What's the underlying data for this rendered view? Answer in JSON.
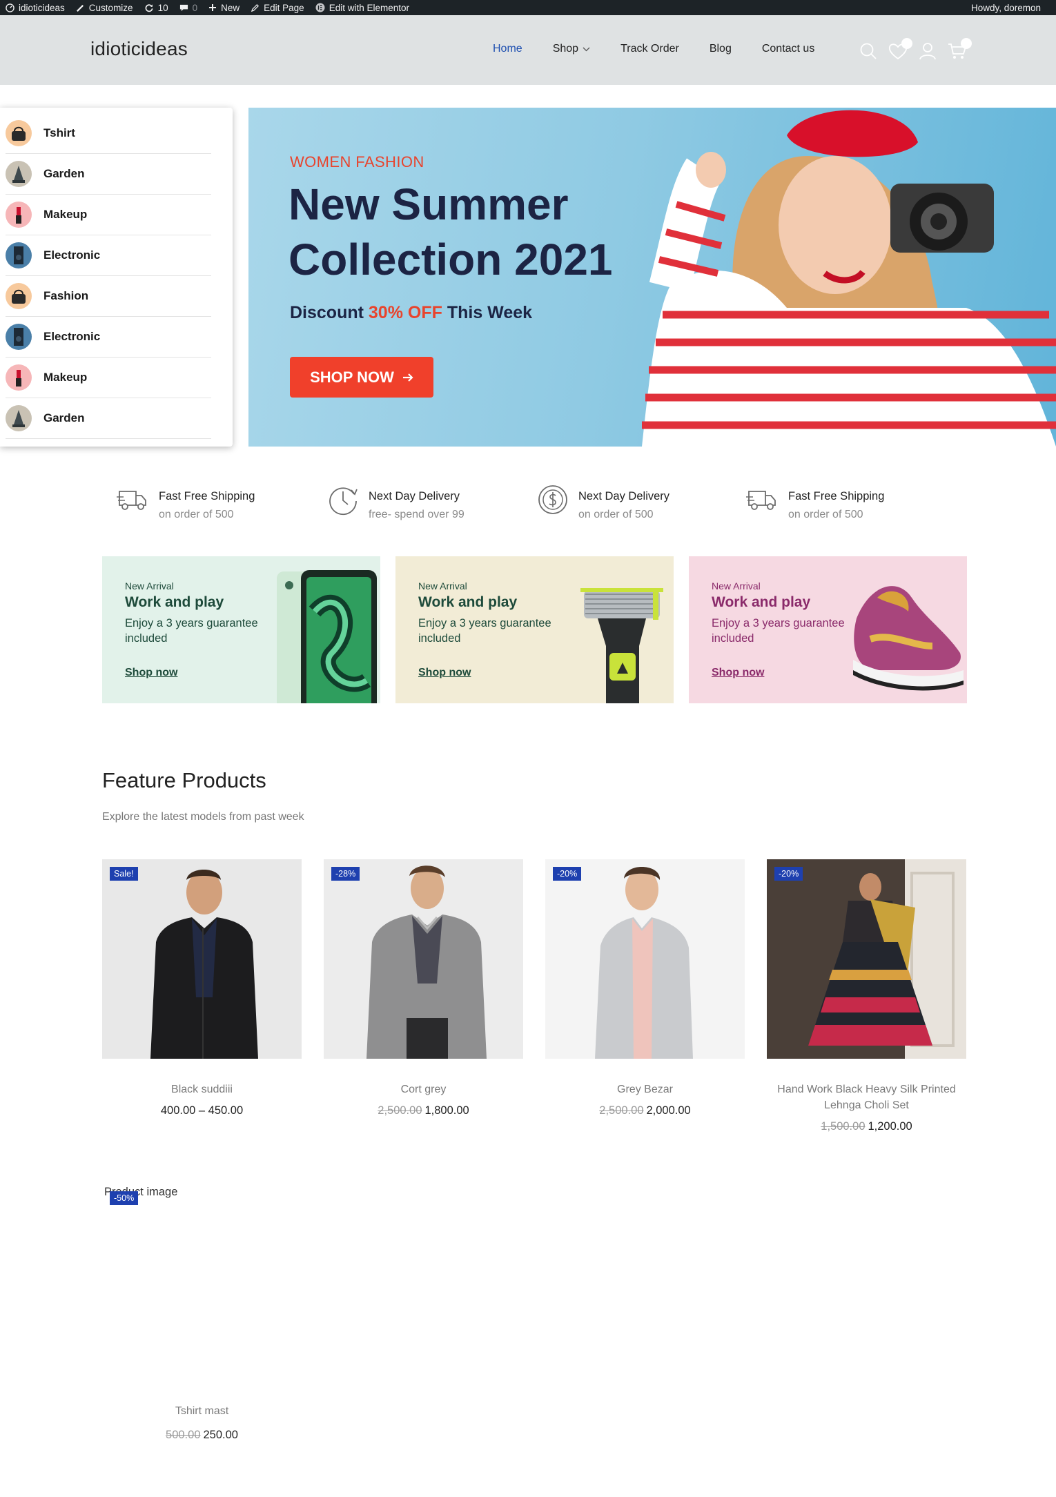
{
  "admin_bar": {
    "site": "idioticideas",
    "customize": "Customize",
    "updates": "10",
    "comments": "0",
    "new": "New",
    "edit_page": "Edit Page",
    "elementor": "Edit with Elementor",
    "howdy": "Howdy, doremon"
  },
  "header": {
    "logo": "idioticideas",
    "nav": [
      "Home",
      "Shop",
      "Track Order",
      "Blog",
      "Contact us"
    ]
  },
  "categories": [
    {
      "label": "Tshirt",
      "icon": "handbag-icon"
    },
    {
      "label": "Garden",
      "icon": "lamp-icon"
    },
    {
      "label": "Makeup",
      "icon": "lipstick-icon"
    },
    {
      "label": "Electronic",
      "icon": "speaker-icon"
    },
    {
      "label": "Fashion",
      "icon": "handbag-icon"
    },
    {
      "label": "Electronic",
      "icon": "speaker-icon"
    },
    {
      "label": "Makeup",
      "icon": "lipstick-icon"
    },
    {
      "label": "Garden",
      "icon": "lamp-icon"
    }
  ],
  "hero": {
    "eyebrow": "WOMEN FASHION",
    "title": "New Summer Collection 2021",
    "discount_pre": "Discount ",
    "discount_hl": "30% OFF",
    "discount_post": " This Week",
    "button": "SHOP NOW"
  },
  "features": [
    {
      "title": "Fast Free Shipping",
      "sub": "on order of 500",
      "icon": "truck-icon"
    },
    {
      "title": "Next Day Delivery",
      "sub": "free- spend over 99",
      "icon": "clock-icon"
    },
    {
      "title": "Next Day Delivery",
      "sub": "on order of 500",
      "icon": "dollar-icon"
    },
    {
      "title": "Fast Free Shipping",
      "sub": "on order of 500",
      "icon": "truck-icon"
    }
  ],
  "promos": [
    {
      "eyebrow": "New Arrival",
      "title": "Work and play",
      "desc": "Enjoy a 3 years guarantee included",
      "link": "Shop now",
      "bg": "#e2f2ea",
      "color": "#1d4a3a"
    },
    {
      "eyebrow": "New Arrival",
      "title": "Work and play",
      "desc": "Enjoy a 3 years guarantee included",
      "link": "Shop now",
      "bg": "#f2ecd6",
      "color": "#1d4a3a"
    },
    {
      "eyebrow": "New Arrival",
      "title": "Work and play",
      "desc": "Enjoy a 3 years guarantee included",
      "link": "Shop now",
      "bg": "#f6d9e2",
      "color": "#8a2a6a"
    }
  ],
  "featured": {
    "title": "Feature Products",
    "subtitle": "Explore the latest models from past week"
  },
  "products": [
    {
      "badge": "Sale!",
      "name": "Black suddiii",
      "old": "",
      "price": "400.00 – 450.00"
    },
    {
      "badge": "-28%",
      "name": "Cort grey",
      "old": "2,500.00",
      "price": "1,800.00"
    },
    {
      "badge": "-20%",
      "name": "Grey Bezar",
      "old": "2,500.00",
      "price": "2,000.00"
    },
    {
      "badge": "-20%",
      "name": "Hand Work Black Heavy Silk Printed Lehnga Choli Set",
      "old": "1,500.00",
      "price": "1,200.00"
    }
  ],
  "product5": {
    "alt": "Product image",
    "badge": "-50%",
    "name": "Tshirt mast",
    "old": "500.00",
    "price": "250.00"
  },
  "colors": {
    "accent": "#1e40af",
    "hero_red": "#f0402b",
    "hero_navy": "#1c2444"
  }
}
